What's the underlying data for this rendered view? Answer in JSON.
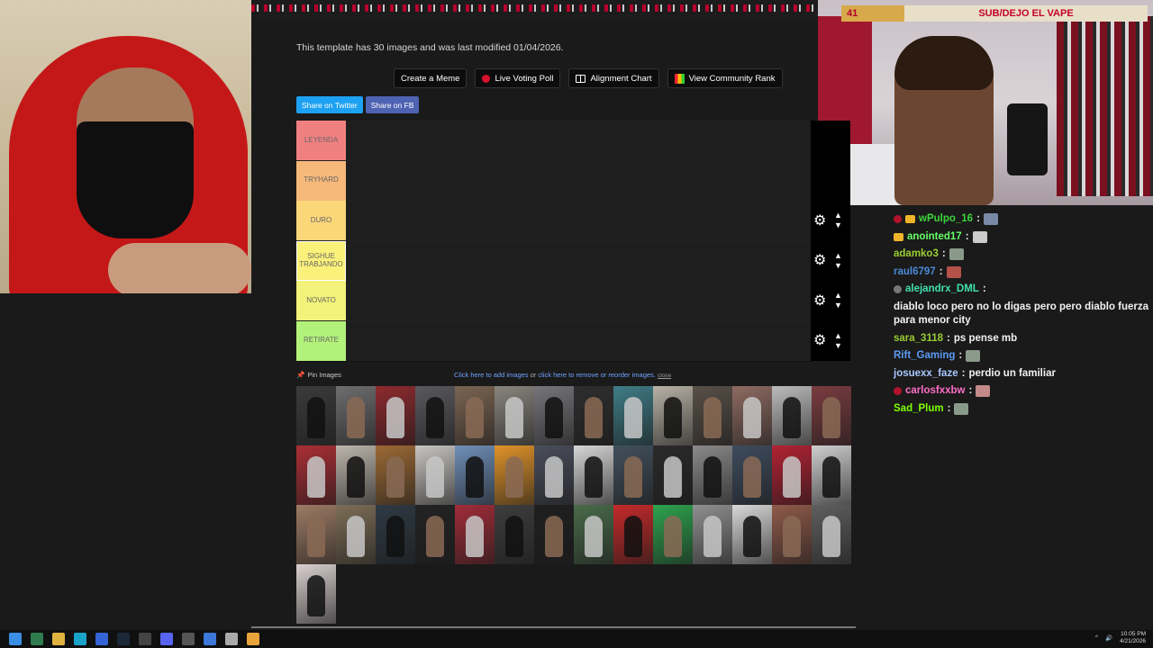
{
  "banner": {
    "count": "41",
    "text": "SUB/DEJO EL VAPE"
  },
  "page": {
    "info": "This template has 30 images and was last modified 01/04/2026.",
    "buttons": {
      "create_meme": "Create a Meme",
      "voting_poll": "Live Voting Poll",
      "alignment_chart": "Alignment Chart",
      "community_rank": "View Community Rank"
    },
    "share": {
      "twitter": "Share on Twitter",
      "facebook": "Share on FB"
    },
    "tiers": [
      {
        "label": "LEYENDA",
        "color": "#f08080"
      },
      {
        "label": "TRYHARD",
        "color": "#f6b97a"
      },
      {
        "label": "DURO",
        "color": "#fbd77a"
      },
      {
        "label": "SIGHUE TRABJANDO",
        "color": "#fbf07a"
      },
      {
        "label": "NOVATO",
        "color": "#f3f27a"
      },
      {
        "label": "RETIRATE",
        "color": "#b3f27a"
      }
    ],
    "pin_images": "Pin Images",
    "add_images": "Click here to add images",
    "or": "or",
    "remove_images": "click here to remove or reorder images.",
    "close": "close",
    "thumbs": [
      "#3b3b3b",
      "#6e6e70",
      "#8d2a2e",
      "#5a5a5e",
      "#7b6552",
      "#89857e",
      "#77757a",
      "#2e2e2e",
      "#3f7c86",
      "#b8b2a6",
      "#585048",
      "#8e6b62",
      "#bcbcbc",
      "#7a3c40",
      "#aa2f35",
      "#bdb6ad",
      "#9c6a35",
      "#c8c5c1",
      "#6f8fb8",
      "#e0932a",
      "#4b4e5c",
      "#d6d6d6",
      "#42505c",
      "#2a2a2a",
      "#8a8a8a",
      "#3e4c5e",
      "#b22233",
      "#cfcfcf",
      "#9e7b66",
      "#7d6e57",
      "#2f3a44",
      "#232323",
      "#a02c38",
      "#3d3d3d",
      "#1f1f1f",
      "#4a6b4a",
      "#c42a2a",
      "#2ea34e",
      "#909090",
      "#d8d8d8",
      "#8f5a4a",
      "#5f5f5f",
      "#d9cfd0"
    ]
  },
  "chat": [
    {
      "user": "wPulpo_16",
      "color": "#3cd63c",
      "badges": [
        "red",
        "crown"
      ],
      "text": "",
      "emote": "#7a8aa6"
    },
    {
      "user": "anointed17",
      "color": "#66ff66",
      "badges": [
        "crown"
      ],
      "text": "",
      "emote": "#cccccc"
    },
    {
      "user": "adamko3",
      "color": "#9acd32",
      "badges": [],
      "text": "",
      "emote": "#8a9a8a"
    },
    {
      "user": "raul6797",
      "color": "#4a8ad6",
      "badges": [],
      "text": "",
      "emote": "#b4524a"
    },
    {
      "user": "alejandrx_DML",
      "color": "#40e0b0",
      "badges": [
        "grey"
      ],
      "text": "diablo loco pero no lo digas pero pero diablo fuerza para menor city",
      "emote": ""
    },
    {
      "user": "sara_3118",
      "color": "#9acd32",
      "badges": [],
      "text": "ps pense mb",
      "emote": ""
    },
    {
      "user": "Rift_Gaming",
      "color": "#5b9bf5",
      "badges": [],
      "text": "",
      "emote": "#8a9a8a"
    },
    {
      "user": "josuexx_faze",
      "color": "#a8c8ff",
      "badges": [],
      "text": "perdio un familiar",
      "emote": ""
    },
    {
      "user": "carlosfxxbw",
      "color": "#ff6ec7",
      "badges": [
        "red"
      ],
      "text": "",
      "emote": "#c38a8a"
    },
    {
      "user": "Sad_Plum",
      "color": "#7fff00",
      "badges": [],
      "text": "",
      "emote": "#8a9a8a"
    }
  ],
  "taskbar": {
    "time": "10:05 PM",
    "date": "4/21/2026"
  }
}
